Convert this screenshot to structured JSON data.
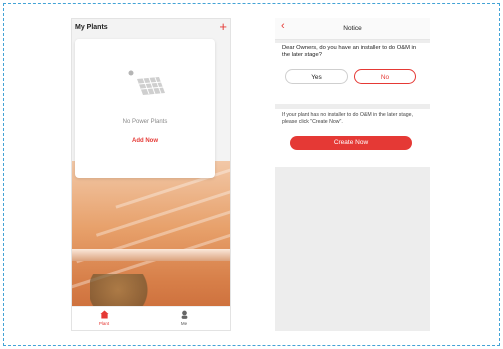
{
  "left_screen": {
    "title": "My Plants",
    "add_icon": "plus-icon",
    "empty_text": "No Power Plants",
    "add_now_label": "Add Now",
    "tabs": [
      {
        "label": "Plant",
        "icon": "home-icon",
        "active": true
      },
      {
        "label": "Me",
        "icon": "user-icon",
        "active": false
      }
    ],
    "accent_color": "#e53935"
  },
  "right_screen": {
    "nav": {
      "back_icon": "chevron-left-icon",
      "title": "Notice"
    },
    "question": "Dear Owners, do you have an installer to do O&M in the later stage?",
    "yes_label": "Yes",
    "no_label": "No",
    "info": "If your plant has no installer to do O&M in the later stage, please click \"Create Now\".",
    "create_label": "Create Now"
  }
}
